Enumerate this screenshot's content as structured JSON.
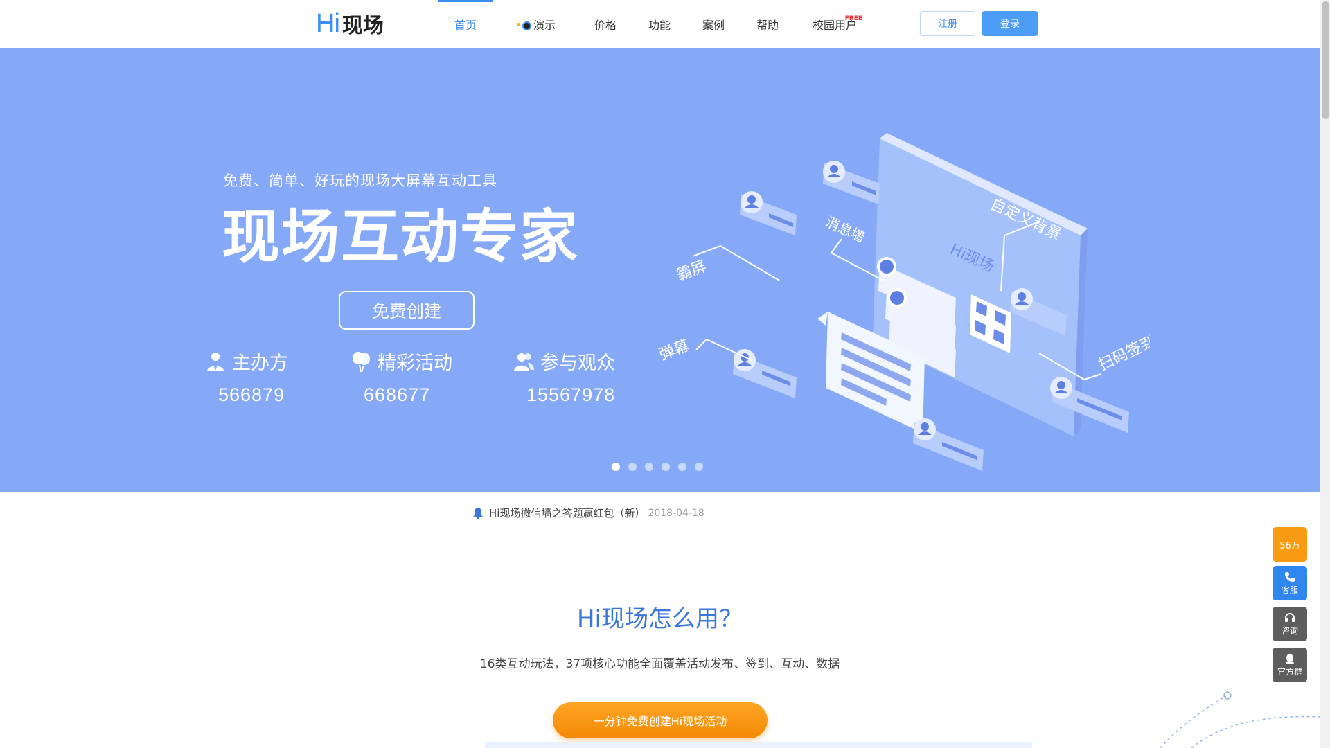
{
  "header": {
    "logo_hi": "Hi",
    "logo_name": "现场",
    "nav": [
      {
        "label": "首页",
        "active": true
      },
      {
        "label": "演示",
        "active": false
      },
      {
        "label": "价格",
        "active": false
      },
      {
        "label": "功能",
        "active": false
      },
      {
        "label": "案例",
        "active": false
      },
      {
        "label": "帮助",
        "active": false
      },
      {
        "label": "校园用户",
        "active": false
      }
    ],
    "free_badge": "FREE",
    "register_label": "注册",
    "login_label": "登录"
  },
  "banner": {
    "subtitle": "免费、简单、好玩的现场大屏幕互动工具",
    "title": "现场互动专家",
    "create_label": "免费创建",
    "stats": [
      {
        "label": "主办方",
        "value": "566879"
      },
      {
        "label": "精彩活动",
        "value": "668677"
      },
      {
        "label": "参与观众",
        "value": "15567978"
      }
    ],
    "illustration_labels": [
      "自定义背景",
      "消息墙",
      "Hi现场",
      "霸屏",
      "弹幕",
      "扫码签到"
    ],
    "slide_count": 6,
    "active_slide": 0
  },
  "notice": {
    "text": "Hi现场微信墙之答题赢红包（新）",
    "date": "2018-04-18"
  },
  "how": {
    "title": "Hi现场怎么用？",
    "subtitle": "16类互动玩法，37项核心功能全面覆盖活动发布、签到、互动、数据",
    "cta_label": "一分钟免费创建Hi现场活动"
  },
  "side": {
    "count_label": "56万",
    "service_label": "客服",
    "consult_label": "咨询",
    "group_label": "官方群"
  },
  "colors": {
    "brand_blue": "#3a8ef5",
    "banner_bg": "#86a9f7",
    "cta_orange": "#f89a12"
  }
}
